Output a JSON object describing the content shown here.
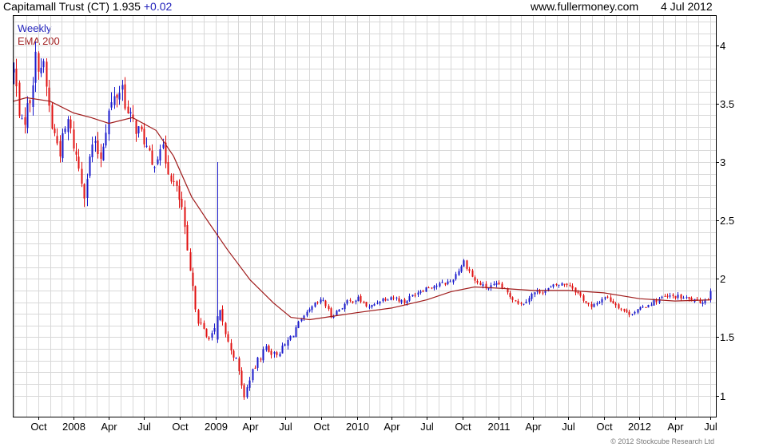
{
  "header": {
    "instrument": "Capitamall Trust (CT)",
    "last": "1.935",
    "change": "+0.02",
    "site": "www.fullermoney.com",
    "date": "4 Jul 2012"
  },
  "legend": {
    "period": "Weekly",
    "ema": "EMA 200"
  },
  "copyright": "© 2012 Stockcube Research Ltd",
  "colors": {
    "up": "#1a1acc",
    "down": "#e01010",
    "ema": "#a01c1c",
    "period_text": "#2222bb",
    "change_text": "#2222bb",
    "ema_text": "#a01c1c",
    "grid": "#d8d8d8"
  },
  "chart_data": {
    "type": "candlestick",
    "period": "weekly",
    "ylim": [
      0.82,
      4.25
    ],
    "y_ticks": [
      1,
      1.5,
      2,
      2.5,
      3,
      3.5,
      4
    ],
    "y_tick_labels": [
      "1",
      "1.5",
      "2",
      "2.5",
      "3",
      "3.5",
      "4"
    ],
    "x_range": [
      "2007-07-30",
      "2012-07-16"
    ],
    "x_ticks": [
      {
        "date": "2007-10-01",
        "label": "Oct"
      },
      {
        "date": "2008-01-01",
        "label": "2008"
      },
      {
        "date": "2008-04-01",
        "label": "Apr"
      },
      {
        "date": "2008-07-01",
        "label": "Jul"
      },
      {
        "date": "2008-10-01",
        "label": "Oct"
      },
      {
        "date": "2009-01-01",
        "label": "2009"
      },
      {
        "date": "2009-04-01",
        "label": "Apr"
      },
      {
        "date": "2009-07-01",
        "label": "Jul"
      },
      {
        "date": "2009-10-01",
        "label": "Oct"
      },
      {
        "date": "2010-01-01",
        "label": "2010"
      },
      {
        "date": "2010-04-01",
        "label": "Apr"
      },
      {
        "date": "2010-07-01",
        "label": "Jul"
      },
      {
        "date": "2010-10-01",
        "label": "Oct"
      },
      {
        "date": "2011-01-01",
        "label": "2011"
      },
      {
        "date": "2011-04-01",
        "label": "Apr"
      },
      {
        "date": "2011-07-01",
        "label": "Jul"
      },
      {
        "date": "2011-10-01",
        "label": "Oct"
      },
      {
        "date": "2012-01-01",
        "label": "2012"
      },
      {
        "date": "2012-04-01",
        "label": "Apr"
      },
      {
        "date": "2012-07-01",
        "label": "Jul"
      }
    ],
    "close_path": [
      [
        "2007-07-30",
        3.78
      ],
      [
        "2007-08-20",
        3.3
      ],
      [
        "2007-09-10",
        3.55
      ],
      [
        "2007-09-24",
        3.88
      ],
      [
        "2007-10-15",
        3.8
      ],
      [
        "2007-11-05",
        3.3
      ],
      [
        "2007-11-26",
        3.1
      ],
      [
        "2007-12-17",
        3.35
      ],
      [
        "2008-01-07",
        3.05
      ],
      [
        "2008-01-28",
        2.75
      ],
      [
        "2008-02-18",
        3.15
      ],
      [
        "2008-03-10",
        3.05
      ],
      [
        "2008-04-01",
        3.45
      ],
      [
        "2008-04-21",
        3.58
      ],
      [
        "2008-05-05",
        3.65
      ],
      [
        "2008-05-19",
        3.4
      ],
      [
        "2008-06-09",
        3.3
      ],
      [
        "2008-06-30",
        3.2
      ],
      [
        "2008-07-21",
        2.95
      ],
      [
        "2008-08-11",
        3.15
      ],
      [
        "2008-09-01",
        2.95
      ],
      [
        "2008-09-22",
        2.75
      ],
      [
        "2008-10-06",
        2.6
      ],
      [
        "2008-10-20",
        2.2
      ],
      [
        "2008-11-03",
        1.9
      ],
      [
        "2008-11-17",
        1.65
      ],
      [
        "2008-12-08",
        1.5
      ],
      [
        "2008-12-29",
        1.55
      ],
      [
        "2009-01-12",
        1.7
      ],
      [
        "2009-02-02",
        1.45
      ],
      [
        "2009-02-23",
        1.3
      ],
      [
        "2009-03-09",
        1.1
      ],
      [
        "2009-03-16",
        0.98
      ],
      [
        "2009-03-30",
        1.15
      ],
      [
        "2009-04-20",
        1.3
      ],
      [
        "2009-05-11",
        1.42
      ],
      [
        "2009-06-01",
        1.35
      ],
      [
        "2009-06-22",
        1.4
      ],
      [
        "2009-07-13",
        1.5
      ],
      [
        "2009-08-03",
        1.62
      ],
      [
        "2009-08-24",
        1.7
      ],
      [
        "2009-09-14",
        1.78
      ],
      [
        "2009-10-05",
        1.82
      ],
      [
        "2009-10-26",
        1.68
      ],
      [
        "2009-11-16",
        1.74
      ],
      [
        "2009-12-07",
        1.8
      ],
      [
        "2010-01-04",
        1.83
      ],
      [
        "2010-02-01",
        1.75
      ],
      [
        "2010-03-01",
        1.82
      ],
      [
        "2010-04-01",
        1.85
      ],
      [
        "2010-05-03",
        1.8
      ],
      [
        "2010-06-01",
        1.88
      ],
      [
        "2010-07-01",
        1.93
      ],
      [
        "2010-08-02",
        1.95
      ],
      [
        "2010-09-01",
        1.98
      ],
      [
        "2010-10-04",
        2.15
      ],
      [
        "2010-11-01",
        1.98
      ],
      [
        "2010-12-01",
        1.92
      ],
      [
        "2011-01-03",
        1.95
      ],
      [
        "2011-02-01",
        1.85
      ],
      [
        "2011-03-01",
        1.78
      ],
      [
        "2011-04-01",
        1.88
      ],
      [
        "2011-05-02",
        1.9
      ],
      [
        "2011-06-01",
        1.95
      ],
      [
        "2011-07-01",
        1.96
      ],
      [
        "2011-08-01",
        1.85
      ],
      [
        "2011-08-29",
        1.75
      ],
      [
        "2011-10-03",
        1.85
      ],
      [
        "2011-11-01",
        1.78
      ],
      [
        "2011-12-01",
        1.7
      ],
      [
        "2012-01-02",
        1.74
      ],
      [
        "2012-02-01",
        1.8
      ],
      [
        "2012-03-01",
        1.84
      ],
      [
        "2012-04-02",
        1.85
      ],
      [
        "2012-05-01",
        1.83
      ],
      [
        "2012-06-01",
        1.8
      ],
      [
        "2012-06-25",
        1.83
      ],
      [
        "2012-07-04",
        1.935
      ]
    ],
    "ema200": [
      [
        "2007-07-30",
        3.52
      ],
      [
        "2007-09-01",
        3.55
      ],
      [
        "2007-11-01",
        3.52
      ],
      [
        "2008-01-01",
        3.42
      ],
      [
        "2008-02-15",
        3.38
      ],
      [
        "2008-04-01",
        3.33
      ],
      [
        "2008-06-01",
        3.38
      ],
      [
        "2008-08-01",
        3.27
      ],
      [
        "2008-09-15",
        3.05
      ],
      [
        "2008-11-01",
        2.7
      ],
      [
        "2008-12-15",
        2.48
      ],
      [
        "2009-02-01",
        2.25
      ],
      [
        "2009-04-01",
        1.99
      ],
      [
        "2009-06-01",
        1.79
      ],
      [
        "2009-07-15",
        1.67
      ],
      [
        "2009-09-01",
        1.65
      ],
      [
        "2009-11-01",
        1.68
      ],
      [
        "2010-01-01",
        1.71
      ],
      [
        "2010-04-01",
        1.75
      ],
      [
        "2010-07-01",
        1.82
      ],
      [
        "2010-09-01",
        1.89
      ],
      [
        "2010-11-01",
        1.93
      ],
      [
        "2011-01-01",
        1.92
      ],
      [
        "2011-04-01",
        1.9
      ],
      [
        "2011-07-01",
        1.9
      ],
      [
        "2011-10-01",
        1.88
      ],
      [
        "2012-01-01",
        1.83
      ],
      [
        "2012-04-01",
        1.81
      ],
      [
        "2012-07-04",
        1.82
      ]
    ],
    "spikes": [
      {
        "date": "2009-01-05",
        "open": 1.48,
        "high": 3.0,
        "low": 1.45,
        "close": 1.68
      }
    ]
  }
}
